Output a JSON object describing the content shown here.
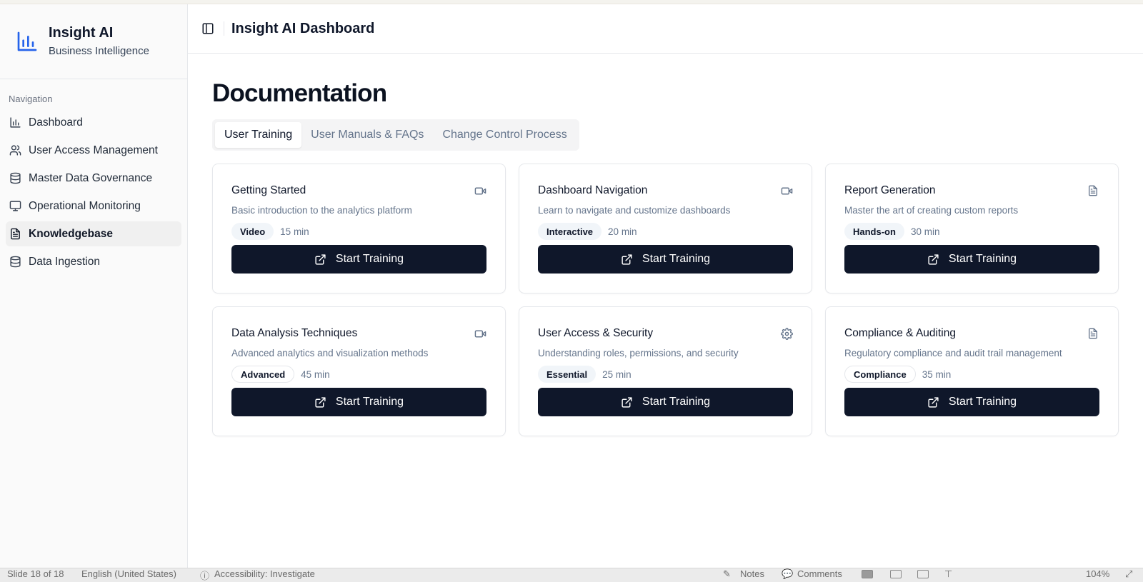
{
  "sidebar": {
    "brand_title": "Insight AI",
    "brand_subtitle": "Business Intelligence",
    "nav_label": "Navigation",
    "items": [
      {
        "label": "Dashboard",
        "icon": "bar-chart-icon"
      },
      {
        "label": "User Access Management",
        "icon": "users-icon"
      },
      {
        "label": "Master Data Governance",
        "icon": "database-icon"
      },
      {
        "label": "Operational Monitoring",
        "icon": "monitor-icon"
      },
      {
        "label": "Knowledgebase",
        "icon": "file-text-icon",
        "active": true
      },
      {
        "label": "Data Ingestion",
        "icon": "database-icon"
      }
    ]
  },
  "header": {
    "title": "Insight AI Dashboard"
  },
  "main": {
    "page_title": "Documentation",
    "tabs": [
      {
        "label": "User Training",
        "active": true
      },
      {
        "label": "User Manuals & FAQs"
      },
      {
        "label": "Change Control Process"
      }
    ],
    "cards": [
      {
        "title": "Getting Started",
        "description": "Basic introduction to the analytics platform",
        "badge": "Video",
        "duration": "15 min",
        "icon": "video-icon",
        "button": "Start Training"
      },
      {
        "title": "Dashboard Navigation",
        "description": "Learn to navigate and customize dashboards",
        "badge": "Interactive",
        "duration": "20 min",
        "icon": "video-icon",
        "button": "Start Training"
      },
      {
        "title": "Report Generation",
        "description": "Master the art of creating custom reports",
        "badge": "Hands-on",
        "duration": "30 min",
        "icon": "file-text-icon",
        "button": "Start Training"
      },
      {
        "title": "Data Analysis Techniques",
        "description": "Advanced analytics and visualization methods",
        "badge": "Advanced",
        "duration": "45 min",
        "icon": "video-icon",
        "button": "Start Training"
      },
      {
        "title": "User Access & Security",
        "description": "Understanding roles, permissions, and security",
        "badge": "Essential",
        "duration": "25 min",
        "icon": "gear-icon",
        "button": "Start Training"
      },
      {
        "title": "Compliance & Auditing",
        "description": "Regulatory compliance and audit trail management",
        "badge": "Compliance",
        "duration": "35 min",
        "icon": "file-text-icon",
        "button": "Start Training"
      }
    ]
  },
  "statusbar": {
    "slide": "Slide 18 of 18",
    "language": "English (United States)",
    "accessibility": "Accessibility: Investigate",
    "notes": "Notes",
    "comments": "Comments",
    "zoom": "104%"
  },
  "colors": {
    "accent": "#2563eb",
    "button_bg": "#0f172a",
    "muted_text": "#64748b"
  }
}
